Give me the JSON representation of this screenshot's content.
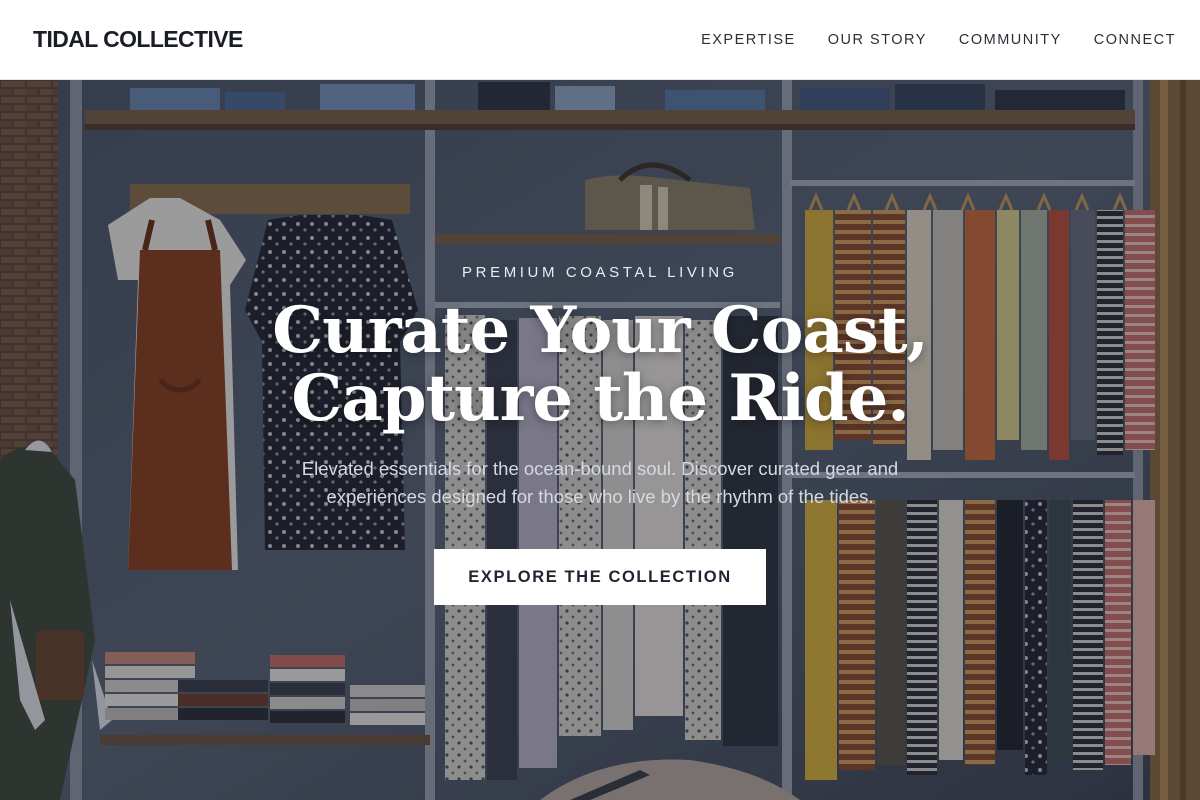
{
  "header": {
    "logo": "TIDAL COLLECTIVE",
    "nav": [
      {
        "label": "EXPERTISE"
      },
      {
        "label": "OUR STORY"
      },
      {
        "label": "COMMUNITY"
      },
      {
        "label": "CONNECT"
      }
    ]
  },
  "hero": {
    "eyebrow": "PREMIUM COASTAL LIVING",
    "headline_line1": "Curate Your Coast,",
    "headline_line2": "Capture the Ride.",
    "subtitle": "Elevated essentials for the ocean-bound soul. Discover curated gear and experiences designed for those who live by the rhythm of the tides.",
    "cta_label": "EXPLORE THE COLLECTION"
  },
  "colors": {
    "header_bg": "#ffffff",
    "text_dark": "#1a1d24",
    "hero_overlay": "#121620",
    "cta_bg": "#ffffff"
  }
}
